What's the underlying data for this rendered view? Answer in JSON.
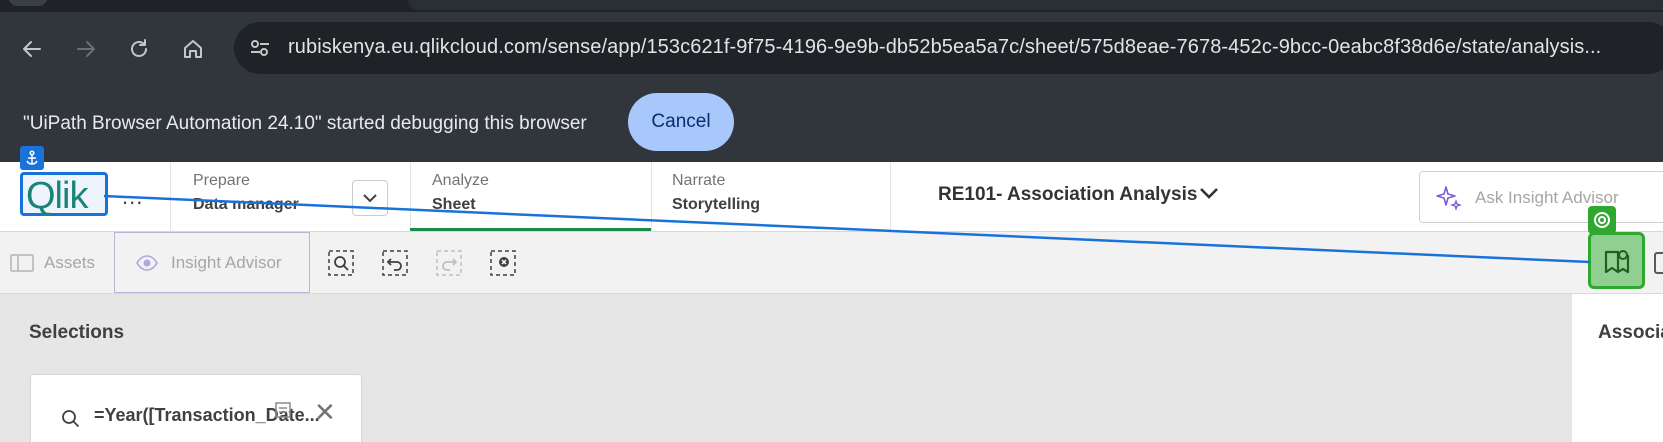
{
  "browser": {
    "url": "rubiskenya.eu.qlikcloud.com/sense/app/153c621f-9f75-4196-9e9b-db52b5ea5a7c/sheet/575d8eae-7678-452c-9bcc-0eabc8f38d6e/state/analysis...",
    "icons": {
      "back": "back-arrow-icon",
      "forward": "forward-arrow-icon",
      "reload": "reload-icon",
      "home": "home-icon",
      "site": "site-settings-icon"
    }
  },
  "infobar": {
    "message": "\"UiPath Browser Automation 24.10\" started debugging this browser",
    "cancel_label": "Cancel"
  },
  "qlik_header": {
    "logo": "Qlik",
    "more": "...",
    "prepare": {
      "sub": "Prepare",
      "main": "Data manager"
    },
    "analyze": {
      "sub": "Analyze",
      "main": "Sheet"
    },
    "narrate": {
      "sub": "Narrate",
      "main": "Storytelling"
    },
    "app_title": "RE101- Association Analysis",
    "ask_placeholder": "Ask Insight Advisor"
  },
  "toolbar": {
    "assets_label": "Assets",
    "insight_label": "Insight Advisor"
  },
  "content": {
    "selections_title": "Selections",
    "selection_value": "=Year([Transaction_Date...",
    "right_panel_title": "Associa"
  },
  "colors": {
    "accent_green": "#1a8a4a",
    "uipath_blue": "#1a72d9",
    "uipath_green": "#2fa82f"
  }
}
